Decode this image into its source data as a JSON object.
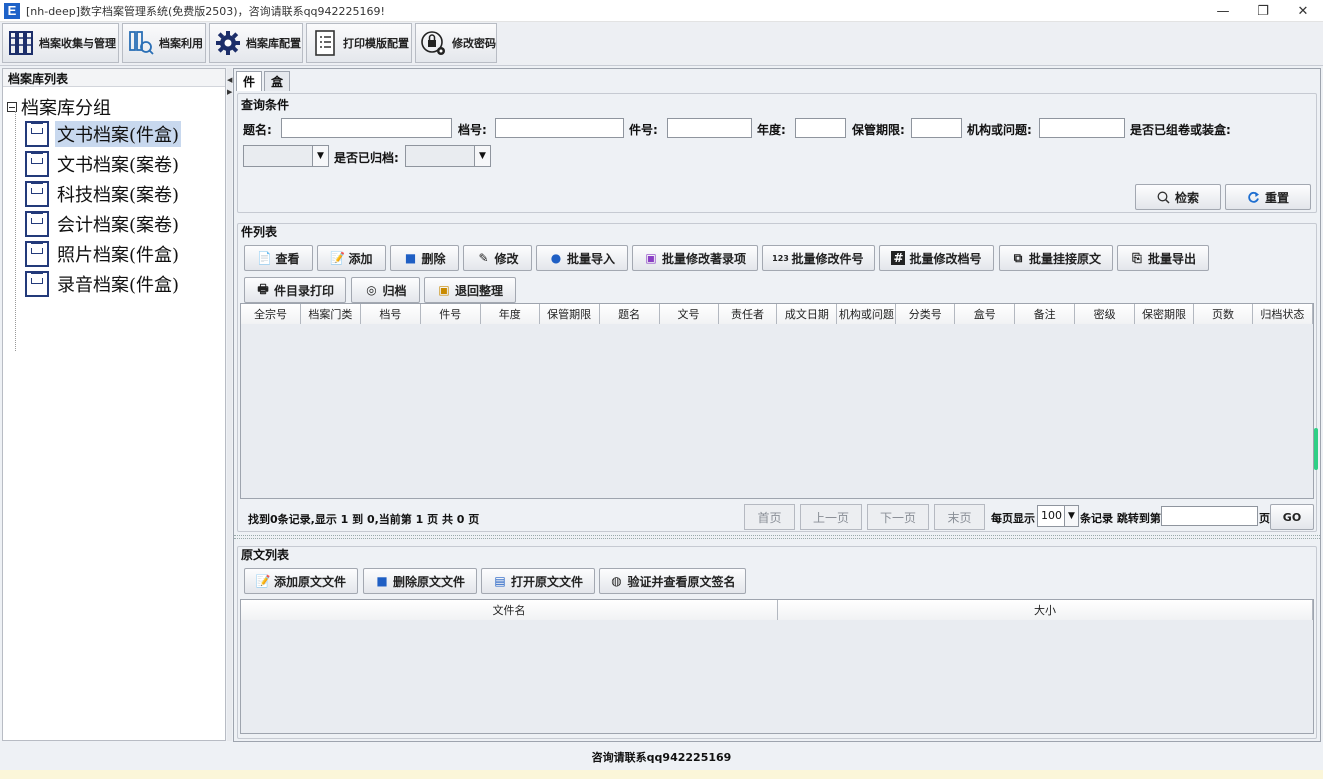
{
  "window": {
    "title": "[nh-deep]数字档案管理系统(免费版2503)，咨询请联系qq942225169!",
    "logo_letter": "E",
    "controls": {
      "minimize": "—",
      "restore": "❐",
      "close": "✕"
    }
  },
  "toolbar": {
    "items": [
      {
        "label": "档案收集与管理",
        "icon": "filing-cabinet-icon"
      },
      {
        "label": "档案利用",
        "icon": "search-document-icon"
      },
      {
        "label": "档案库配置",
        "icon": "gear-icon"
      },
      {
        "label": "打印模版配置",
        "icon": "template-icon"
      },
      {
        "label": "修改密码",
        "icon": "lock-gear-icon"
      }
    ]
  },
  "sidebar": {
    "header": "档案库列表",
    "root": "档案库分组",
    "items": [
      {
        "label": "文书档案(件盒)",
        "selected": true
      },
      {
        "label": "文书档案(案卷)"
      },
      {
        "label": "科技档案(案卷)"
      },
      {
        "label": "会计档案(案卷)"
      },
      {
        "label": "照片档案(件盒)"
      },
      {
        "label": "录音档案(件盒)"
      }
    ]
  },
  "tabs": [
    "件",
    "盒"
  ],
  "query": {
    "title": "查询条件",
    "labels": {
      "title": "题名:",
      "archive_no": "档号:",
      "item_no": "件号:",
      "year": "年度:",
      "retention": "保管期限:",
      "org": "机构或问题:",
      "boxed": "是否已组卷或装盒:",
      "archived": "是否已归档:"
    },
    "values": {
      "title": "",
      "archive_no": "",
      "item_no": "",
      "year": "",
      "retention": "",
      "org": "",
      "boxed": "",
      "archived": ""
    },
    "search_btn": "检索",
    "reset_btn": "重置"
  },
  "list": {
    "title": "件列表",
    "buttons_row1": [
      "查看",
      "添加",
      "删除",
      "修改",
      "批量导入",
      "批量修改著录项",
      "批量修改件号",
      "批量修改档号",
      "批量挂接原文",
      "批量导出"
    ],
    "buttons_row2": [
      "件目录打印",
      "归档",
      "退回整理"
    ],
    "columns": [
      "全宗号",
      "档案门类",
      "档号",
      "件号",
      "年度",
      "保管期限",
      "题名",
      "文号",
      "责任者",
      "成文日期",
      "机构或问题",
      "分类号",
      "盒号",
      "备注",
      "密级",
      "保密期限",
      "页数",
      "归档状态"
    ],
    "rows": []
  },
  "pagination": {
    "status": "找到0条记录,显示 1 到 0,当前第 1 页 共 0 页",
    "first": "首页",
    "prev": "上一页",
    "next": "下一页",
    "last": "末页",
    "per_page_label": "每页显示",
    "per_page_value": "100",
    "jump_label": "条记录 跳转到第",
    "page_input": "",
    "page_suffix": "页",
    "go": "GO"
  },
  "originals": {
    "title": "原文列表",
    "buttons": [
      "添加原文文件",
      "删除原文文件",
      "打开原文文件",
      "验证并查看原文签名"
    ],
    "columns": [
      "文件名",
      "大小"
    ],
    "rows": []
  },
  "footer": {
    "text": "咨询请联系qq942225169"
  },
  "colors": {
    "accent": "#1e62c8",
    "selected": "#c8d8ee",
    "cabinet": "#233a7a"
  }
}
